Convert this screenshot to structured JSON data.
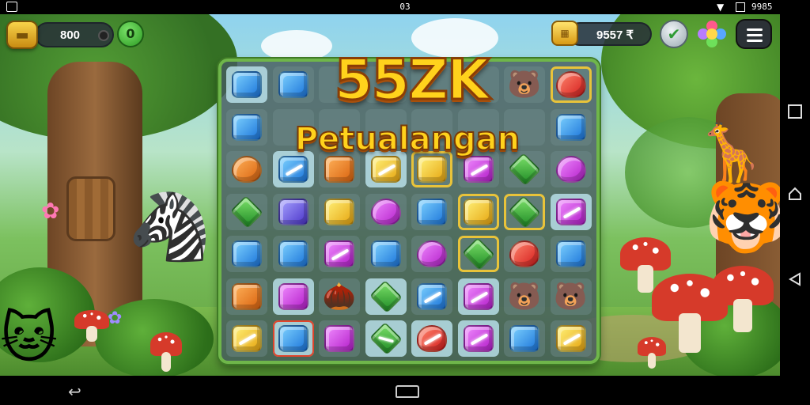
{
  "status_bar": {
    "clock": "03",
    "right_time": "9985"
  },
  "hud": {
    "coins": "800",
    "add_label": "0",
    "gold": "9557 ₹",
    "gold_icon_glyph": "▦",
    "check_glyph": "✔",
    "menu_icon": "hamburger-menu-icon"
  },
  "title": {
    "main": "55ZK",
    "subtitle": "Petualangan"
  },
  "board": {
    "rows": [
      [
        "blue",
        "blue",
        "",
        "",
        "",
        "",
        "critter-bear",
        "red-heart"
      ],
      [
        "blue",
        "",
        "",
        "",
        "",
        "",
        "",
        "blue"
      ],
      [
        "orange-heart",
        "blue-special",
        "orange",
        "yellow-special",
        "yellow",
        "purple-special",
        "green",
        "purple-heart"
      ],
      [
        "green",
        "indigo",
        "yellow",
        "purple-heart",
        "blue",
        "yellow",
        "green",
        "purple-special"
      ],
      [
        "blue",
        "blue",
        "purple-special",
        "blue",
        "purple-heart",
        "green",
        "red-heart",
        "blue"
      ],
      [
        "orange",
        "purple",
        "critter-nut",
        "green",
        "blue-special",
        "purple-special",
        "critter-bear",
        "critter-bear"
      ],
      [
        "yellow-special",
        "blue",
        "purple",
        "green-special",
        "red-special",
        "purple-special",
        "blue",
        "yellow-special"
      ]
    ],
    "highlighted": [
      "0-0",
      "2-1",
      "2-3",
      "3-7",
      "5-1",
      "5-3",
      "5-5",
      "6-1",
      "6-3",
      "6-4",
      "6-5"
    ],
    "gold_frames": [
      "2-4",
      "3-5",
      "3-6",
      "4-5",
      "0-7"
    ],
    "red_frame": [
      "6-1"
    ]
  },
  "colors": {
    "board_border": "#6fb64a",
    "title_fill": "#ffd21c",
    "title_stroke": "#8a3d05"
  },
  "nav": {
    "back_glyph": "↩"
  }
}
